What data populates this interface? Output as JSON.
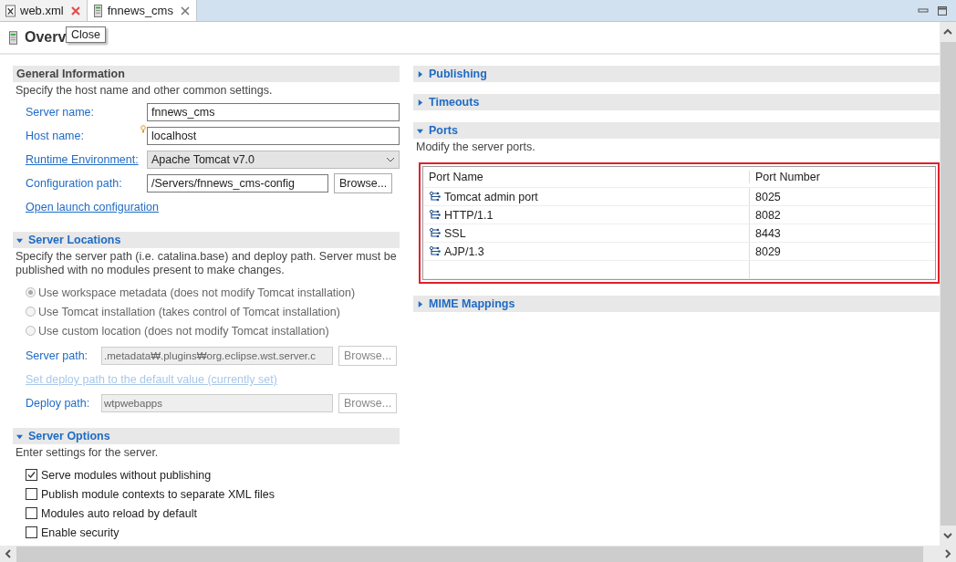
{
  "tabs": [
    {
      "label": "web.xml",
      "kind": "xml",
      "selected": false
    },
    {
      "label": "fnnews_cms",
      "kind": "server",
      "selected": true
    }
  ],
  "tooltip": "Close",
  "page_title": "Overv",
  "general": {
    "title": "General Information",
    "description": "Specify the host name and other common settings.",
    "fields": [
      {
        "label": "Server name:",
        "link": false,
        "kind": "text",
        "value": "fnnews_cms"
      },
      {
        "label": "Host name:",
        "link": false,
        "kind": "hint-text",
        "value": "localhost"
      },
      {
        "label": "Runtime Environment:",
        "link": true,
        "kind": "select",
        "value": "Apache Tomcat v7.0"
      },
      {
        "label": "Configuration path:",
        "link": false,
        "kind": "browse",
        "value": "/Servers/fnnews_cms-config",
        "button": "Browse..."
      }
    ],
    "link": "Open launch configuration"
  },
  "locations": {
    "title": "Server Locations",
    "expanded": true,
    "description": "Specify the server path (i.e. catalina.base) and deploy path. Server must be published with no modules present to make changes.",
    "options": [
      {
        "label": "Use workspace metadata (does not modify Tomcat installation)",
        "selected": true,
        "disabled": true
      },
      {
        "label": "Use Tomcat installation (takes control of Tomcat installation)",
        "selected": false,
        "disabled": true
      },
      {
        "label": "Use custom location (does not modify Tomcat installation)",
        "selected": false,
        "disabled": true
      }
    ],
    "server_path": {
      "label": "Server path:",
      "value": ".metadata₩.plugins₩org.eclipse.wst.server.c",
      "button": "Browse...",
      "disabled": true
    },
    "deploy_link": {
      "label": "Set deploy path to the default value (currently set)",
      "disabled": true
    },
    "deploy_path": {
      "label": "Deploy path:",
      "value": "wtpwebapps",
      "button": "Browse...",
      "disabled": true
    }
  },
  "options": {
    "title": "Server Options",
    "expanded": true,
    "description": "Enter settings for the server.",
    "items": [
      {
        "label": "Serve modules without publishing",
        "checked": true
      },
      {
        "label": "Publish module contexts to separate XML files",
        "checked": false
      },
      {
        "label": "Modules auto reload by default",
        "checked": false
      },
      {
        "label": "Enable security",
        "checked": false
      }
    ]
  },
  "right_sections": [
    {
      "title": "Publishing",
      "expanded": false
    },
    {
      "title": "Timeouts",
      "expanded": false
    },
    {
      "title": "Ports",
      "expanded": true,
      "description": "Modify the server ports.",
      "table": {
        "columns": [
          "Port Name",
          "Port Number"
        ],
        "rows": [
          {
            "name": "Tomcat admin port",
            "number": "8025"
          },
          {
            "name": "HTTP/1.1",
            "number": "8082"
          },
          {
            "name": "SSL",
            "number": "8443"
          },
          {
            "name": "AJP/1.3",
            "number": "8029"
          }
        ]
      }
    },
    {
      "title": "MIME Mappings",
      "expanded": false
    }
  ]
}
